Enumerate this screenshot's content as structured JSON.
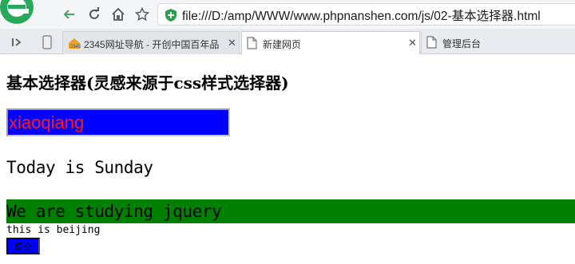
{
  "browser": {
    "address": "file:///D:/amp/WWW/www.phpnanshen.com/js/02-基本选择器.html",
    "tabs": [
      {
        "label": "2345网址导航 - 开创中国百年品",
        "state": "inactive",
        "closable": true
      },
      {
        "label": "新建网页",
        "state": "active",
        "closable": true
      },
      {
        "label": "管理后台",
        "state": "plain",
        "closable": false
      }
    ],
    "colors": {
      "logo": "#27a85a",
      "shield": "#2e9d4c",
      "back_arrow": "#4aa35a"
    }
  },
  "page": {
    "heading": "基本选择器(灵感来源于css样式选择器)",
    "input_value": "xiaoqiang",
    "line_today": "Today is Sunday",
    "line_studying": "We are studying jquery",
    "line_beijing": "this is beijing",
    "submit_label": "提交",
    "colors": {
      "input_bg": "#0000ff",
      "input_text": "#ff1a1a",
      "bar_bg": "#008000",
      "button_bg": "#0000ff"
    }
  }
}
